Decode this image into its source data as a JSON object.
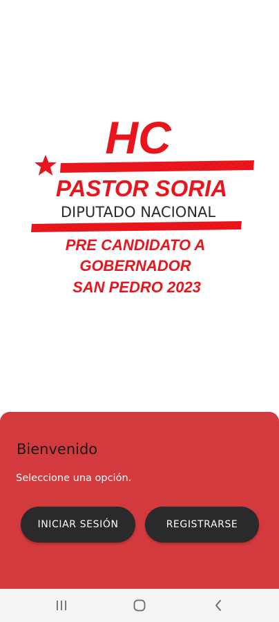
{
  "logo": {
    "initials": "HC",
    "name": "PASTOR SORIA",
    "role": "DIPUTADO NACIONAL",
    "line1": "PRE CANDIDATO A",
    "line2": "GOBERNADOR",
    "line3": "SAN PEDRO 2023",
    "color": "#e8151c"
  },
  "sheet": {
    "title": "Bienvenido",
    "subtitle": "Seleccione una opción.",
    "login_label": "INICIAR SESIÓN",
    "register_label": "REGISTRARSE",
    "background": "#d33a3e",
    "button_color": "#2a2a2d"
  },
  "navbar": {
    "icons": [
      "recent-apps-icon",
      "home-icon",
      "back-icon"
    ]
  }
}
